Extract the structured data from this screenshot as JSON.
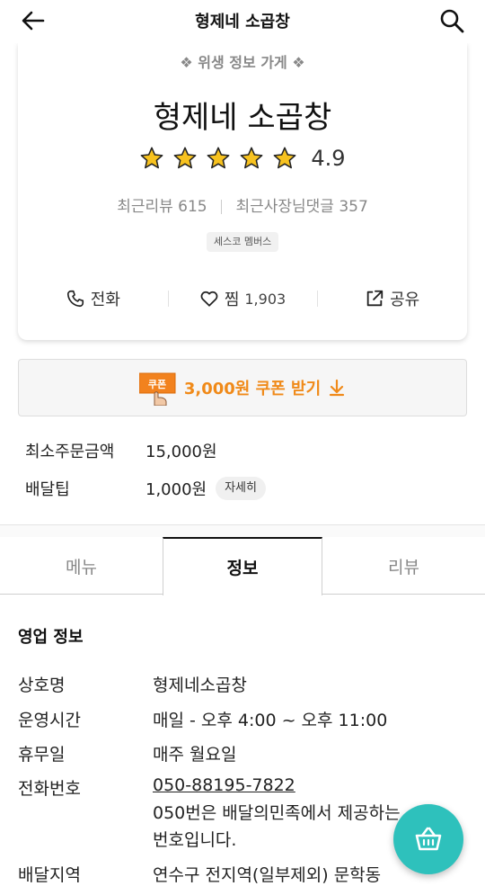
{
  "header": {
    "title": "형제네 소곱창",
    "back_icon": "arrow-left-icon",
    "search_icon": "search-icon"
  },
  "store": {
    "hygiene_label": "❖ 위생 정보 가게 ❖",
    "name": "형제네 소곱창",
    "rating_stars": 5,
    "rating": "4.9",
    "recent_reviews": "최근리뷰 615",
    "owner_replies": "최근사장님댓글 357",
    "member_badge": "세스코 멤버스"
  },
  "actions": {
    "call_label": "전화",
    "like_label": "찜",
    "like_count": "1,903",
    "share_label": "공유"
  },
  "coupon": {
    "icon_text": "쿠폰",
    "label": "3,000원 쿠폰 받기",
    "accent": "#f08a19"
  },
  "order": {
    "min_order_label": "최소주문금액",
    "min_order_value": "15,000원",
    "delivery_tip_label": "배달팁",
    "delivery_tip_value": "1,000원",
    "detail_button": "자세히"
  },
  "tabs": {
    "menu": "메뉴",
    "info": "정보",
    "review": "리뷰",
    "active": "정보"
  },
  "business_info": {
    "section_title": "영업 정보",
    "rows": [
      {
        "key": "상호명",
        "value": "형제네소곱창"
      },
      {
        "key": "운영시간",
        "value": "매일 - 오후 4:00 ~ 오후 11:00"
      },
      {
        "key": "휴무일",
        "value": "매주 월요일"
      },
      {
        "key": "전화번호",
        "value": "050-88195-7822"
      },
      {
        "key": "배달지역",
        "value": "연수구 전지역(일부제외) 문학동"
      }
    ],
    "phone_note_line1": "050번은 배달의민족에서 제공하는",
    "phone_note_line2": "번호입니다."
  },
  "fab": {
    "icon": "shopping-basket-icon",
    "color": "#2ec1bc"
  }
}
